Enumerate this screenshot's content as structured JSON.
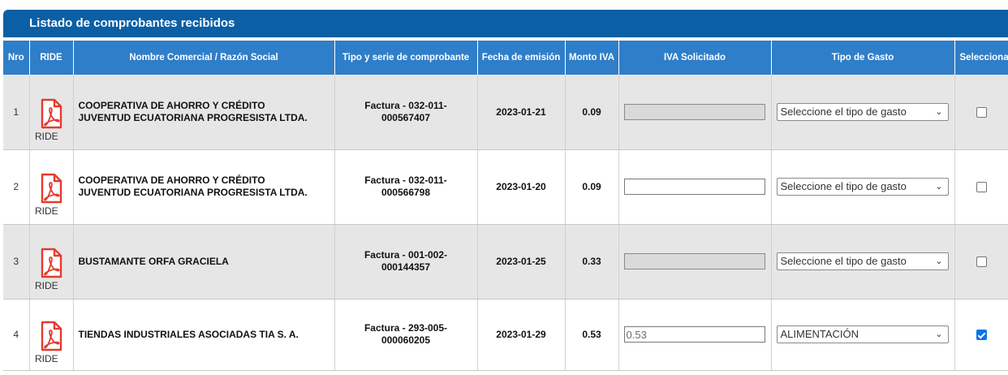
{
  "panel": {
    "title": "Listado de comprobantes recibidos"
  },
  "columns": {
    "nro": "Nro",
    "ride": "RIDE",
    "nombre": "Nombre Comercial / Razón Social",
    "tipo": "Tipo y serie de comprobante",
    "fecha": "Fecha de emisión",
    "monto": "Monto IVA",
    "iva": "IVA Solicitado",
    "gasto": "Tipo de Gasto",
    "seleccionar": "Selecciona"
  },
  "rows": [
    {
      "nro": "1",
      "ride_label": "RIDE",
      "nombre_line1": "COOPERATIVA DE AHORRO Y CRÉDITO",
      "nombre_line2": "JUVENTUD ECUATORIANA PROGRESISTA LTDA.",
      "tipo_line1": "Factura - 032-011-",
      "tipo_line2": "000567407",
      "fecha": "2023-01-21",
      "monto": "0.09",
      "iva_value": "",
      "iva_enabled": false,
      "gasto": "Seleccione el tipo de gasto",
      "selected": false
    },
    {
      "nro": "2",
      "ride_label": "RIDE",
      "nombre_line1": "COOPERATIVA DE AHORRO Y CRÉDITO",
      "nombre_line2": "JUVENTUD ECUATORIANA PROGRESISTA LTDA.",
      "tipo_line1": "Factura - 032-011-",
      "tipo_line2": "000566798",
      "fecha": "2023-01-20",
      "monto": "0.09",
      "iva_value": "",
      "iva_enabled": true,
      "gasto": "Seleccione el tipo de gasto",
      "selected": false
    },
    {
      "nro": "3",
      "ride_label": "RIDE",
      "nombre_line1": "BUSTAMANTE ORFA GRACIELA",
      "nombre_line2": "",
      "tipo_line1": "Factura - 001-002-",
      "tipo_line2": "000144357",
      "fecha": "2023-01-25",
      "monto": "0.33",
      "iva_value": "",
      "iva_enabled": false,
      "gasto": "Seleccione el tipo de gasto",
      "selected": false
    },
    {
      "nro": "4",
      "ride_label": "RIDE",
      "nombre_line1": "TIENDAS INDUSTRIALES ASOCIADAS TIA S. A.",
      "nombre_line2": "",
      "tipo_line1": "Factura - 293-005-",
      "tipo_line2": "000060205",
      "fecha": "2023-01-29",
      "monto": "0.53",
      "iva_value": "0.53",
      "iva_enabled": true,
      "gasto": "ALIMENTACIÓN",
      "selected": true
    }
  ],
  "icons": {
    "pdf": "pdf-file-icon",
    "chevron": "chevron-down-icon",
    "checkbox": "checkbox-icon"
  },
  "colors": {
    "header_bar": "#0b5fa5",
    "column_header": "#2f7ec9",
    "row_alt": "#e6e6e6",
    "pdf_red": "#e53a2f",
    "checkbox_checked": "#0b74e5"
  }
}
